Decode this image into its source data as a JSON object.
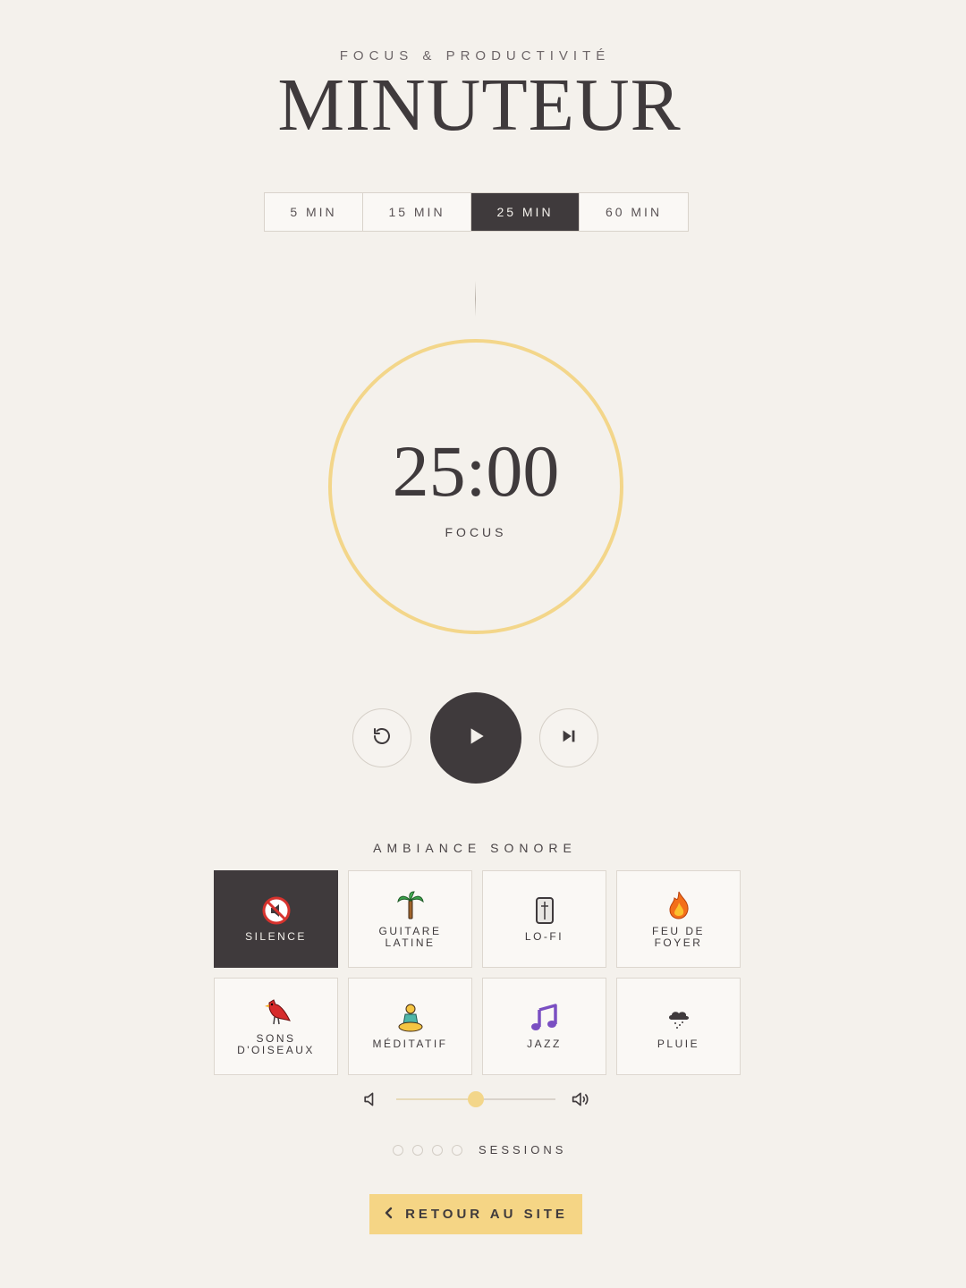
{
  "header": {
    "eyebrow": "FOCUS & PRODUCTIVITÉ",
    "title": "MINUTEUR"
  },
  "durations": [
    {
      "label": "5 MIN",
      "active": false
    },
    {
      "label": "15 MIN",
      "active": false
    },
    {
      "label": "25 MIN",
      "active": true
    },
    {
      "label": "60 MIN",
      "active": false
    }
  ],
  "timer": {
    "time": "25:00",
    "phase": "FOCUS",
    "progress": 0,
    "ring_color": "#f3d68a"
  },
  "controls": {
    "reset_icon": "reset-icon",
    "play_icon": "play-icon",
    "skip_icon": "skip-next-icon"
  },
  "ambiance": {
    "label": "AMBIANCE SONORE",
    "items": [
      {
        "label": "SILENCE",
        "icon": "muted-speaker-icon",
        "active": true
      },
      {
        "label": "GUITARE LATINE",
        "icon": "palm-tree-icon",
        "active": false
      },
      {
        "label": "LO-FI",
        "icon": "radio-icon",
        "active": false
      },
      {
        "label": "FEU DE FOYER",
        "icon": "fire-icon",
        "active": false
      },
      {
        "label": "SONS D'OISEAUX",
        "icon": "bird-icon",
        "active": false
      },
      {
        "label": "MÉDITATIF",
        "icon": "meditation-icon",
        "active": false
      },
      {
        "label": "JAZZ",
        "icon": "music-note-icon",
        "active": false
      },
      {
        "label": "PLUIE",
        "icon": "rain-cloud-icon",
        "active": false
      }
    ]
  },
  "volume": {
    "level": 0.5
  },
  "sessions": {
    "count": 4,
    "completed": 0,
    "label": "SESSIONS"
  },
  "back_button": {
    "label": "RETOUR AU SITE"
  },
  "colors": {
    "accent": "#f3d68a",
    "dark": "#3f3a3c",
    "background": "#f4f1ec"
  }
}
